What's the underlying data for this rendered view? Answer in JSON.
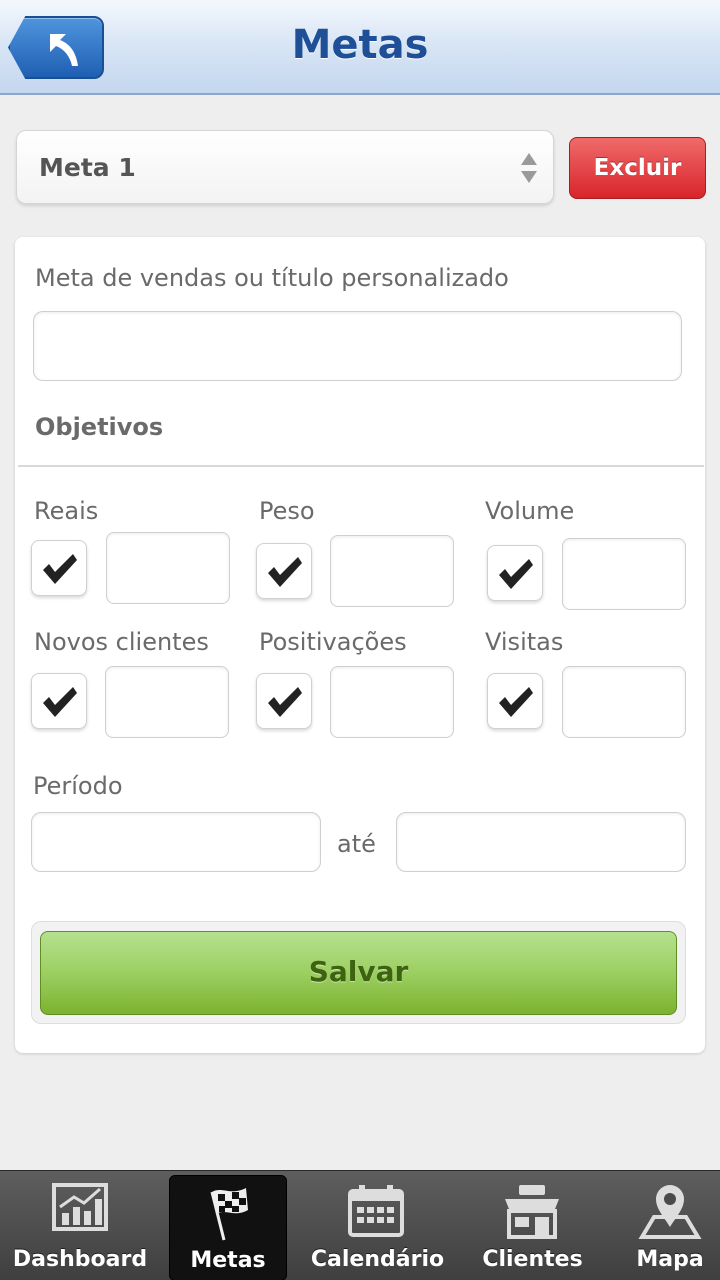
{
  "header": {
    "title": "Metas"
  },
  "meta_select": {
    "value": "Meta 1"
  },
  "delete_button": {
    "label": "Excluir"
  },
  "form": {
    "title_label": "Meta de vendas ou título personalizado",
    "title_value": "",
    "objectives_heading": "Objetivos",
    "objectives": [
      {
        "label": "Reais",
        "checked": true,
        "value": ""
      },
      {
        "label": "Peso",
        "checked": true,
        "value": ""
      },
      {
        "label": "Volume",
        "checked": true,
        "value": ""
      },
      {
        "label": "Novos clientes",
        "checked": true,
        "value": ""
      },
      {
        "label": "Positivações",
        "checked": true,
        "value": ""
      },
      {
        "label": "Visitas",
        "checked": true,
        "value": ""
      }
    ],
    "period_label": "Período",
    "period_from": "",
    "period_separator": "até",
    "period_to": "",
    "save_label": "Salvar"
  },
  "tabbar": {
    "active": "Metas",
    "items": [
      {
        "label": "Dashboard",
        "icon": "chart-icon"
      },
      {
        "label": "Metas",
        "icon": "checkered-flag-icon"
      },
      {
        "label": "Calendário",
        "icon": "calendar-icon"
      },
      {
        "label": "Clientes",
        "icon": "shop-icon"
      },
      {
        "label": "Mapa",
        "icon": "map-pin-icon"
      }
    ]
  },
  "colors": {
    "header_title": "#1e4f97",
    "back_button": "#2f73c6",
    "delete_button": "#d8252b",
    "save_button": "#8cc34b",
    "tabbar": "#4a4a4a"
  }
}
